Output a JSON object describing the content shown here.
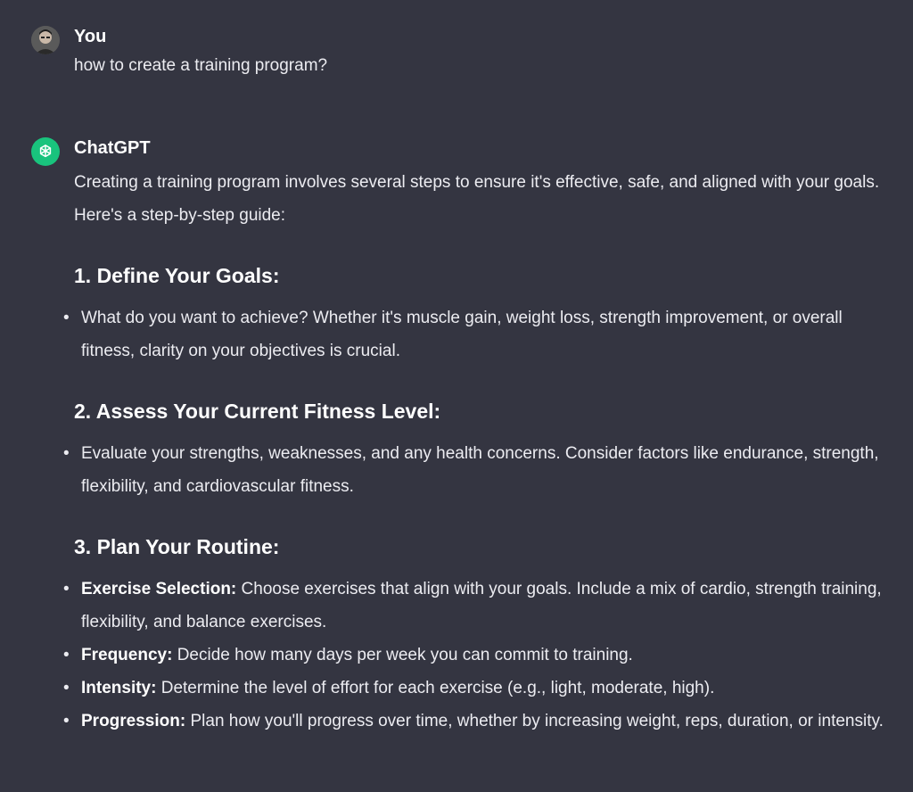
{
  "user_message": {
    "author": "You",
    "text": "how to create a training program?"
  },
  "assistant_message": {
    "author": "ChatGPT",
    "intro": "Creating a training program involves several steps to ensure it's effective, safe, and aligned with your goals. Here's a step-by-step guide:",
    "sections": [
      {
        "heading": "1. Define Your Goals:",
        "bullets": [
          {
            "bold": "",
            "text": "What do you want to achieve? Whether it's muscle gain, weight loss, strength improvement, or overall fitness, clarity on your objectives is crucial."
          }
        ]
      },
      {
        "heading": "2. Assess Your Current Fitness Level:",
        "bullets": [
          {
            "bold": "",
            "text": "Evaluate your strengths, weaknesses, and any health concerns. Consider factors like endurance, strength, flexibility, and cardiovascular fitness."
          }
        ]
      },
      {
        "heading": "3. Plan Your Routine:",
        "bullets": [
          {
            "bold": "Exercise Selection:",
            "text": " Choose exercises that align with your goals. Include a mix of cardio, strength training, flexibility, and balance exercises."
          },
          {
            "bold": "Frequency:",
            "text": " Decide how many days per week you can commit to training."
          },
          {
            "bold": "Intensity:",
            "text": " Determine the level of effort for each exercise (e.g., light, moderate, high)."
          },
          {
            "bold": "Progression:",
            "text": " Plan how you'll progress over time, whether by increasing weight, reps, duration, or intensity."
          }
        ]
      }
    ]
  },
  "icons": {
    "user_avatar": "user-photo-avatar",
    "assistant_avatar": "openai-logo-icon"
  },
  "colors": {
    "background": "#343541",
    "assistant_avatar_bg": "#19c37d",
    "text": "#ececf1"
  }
}
